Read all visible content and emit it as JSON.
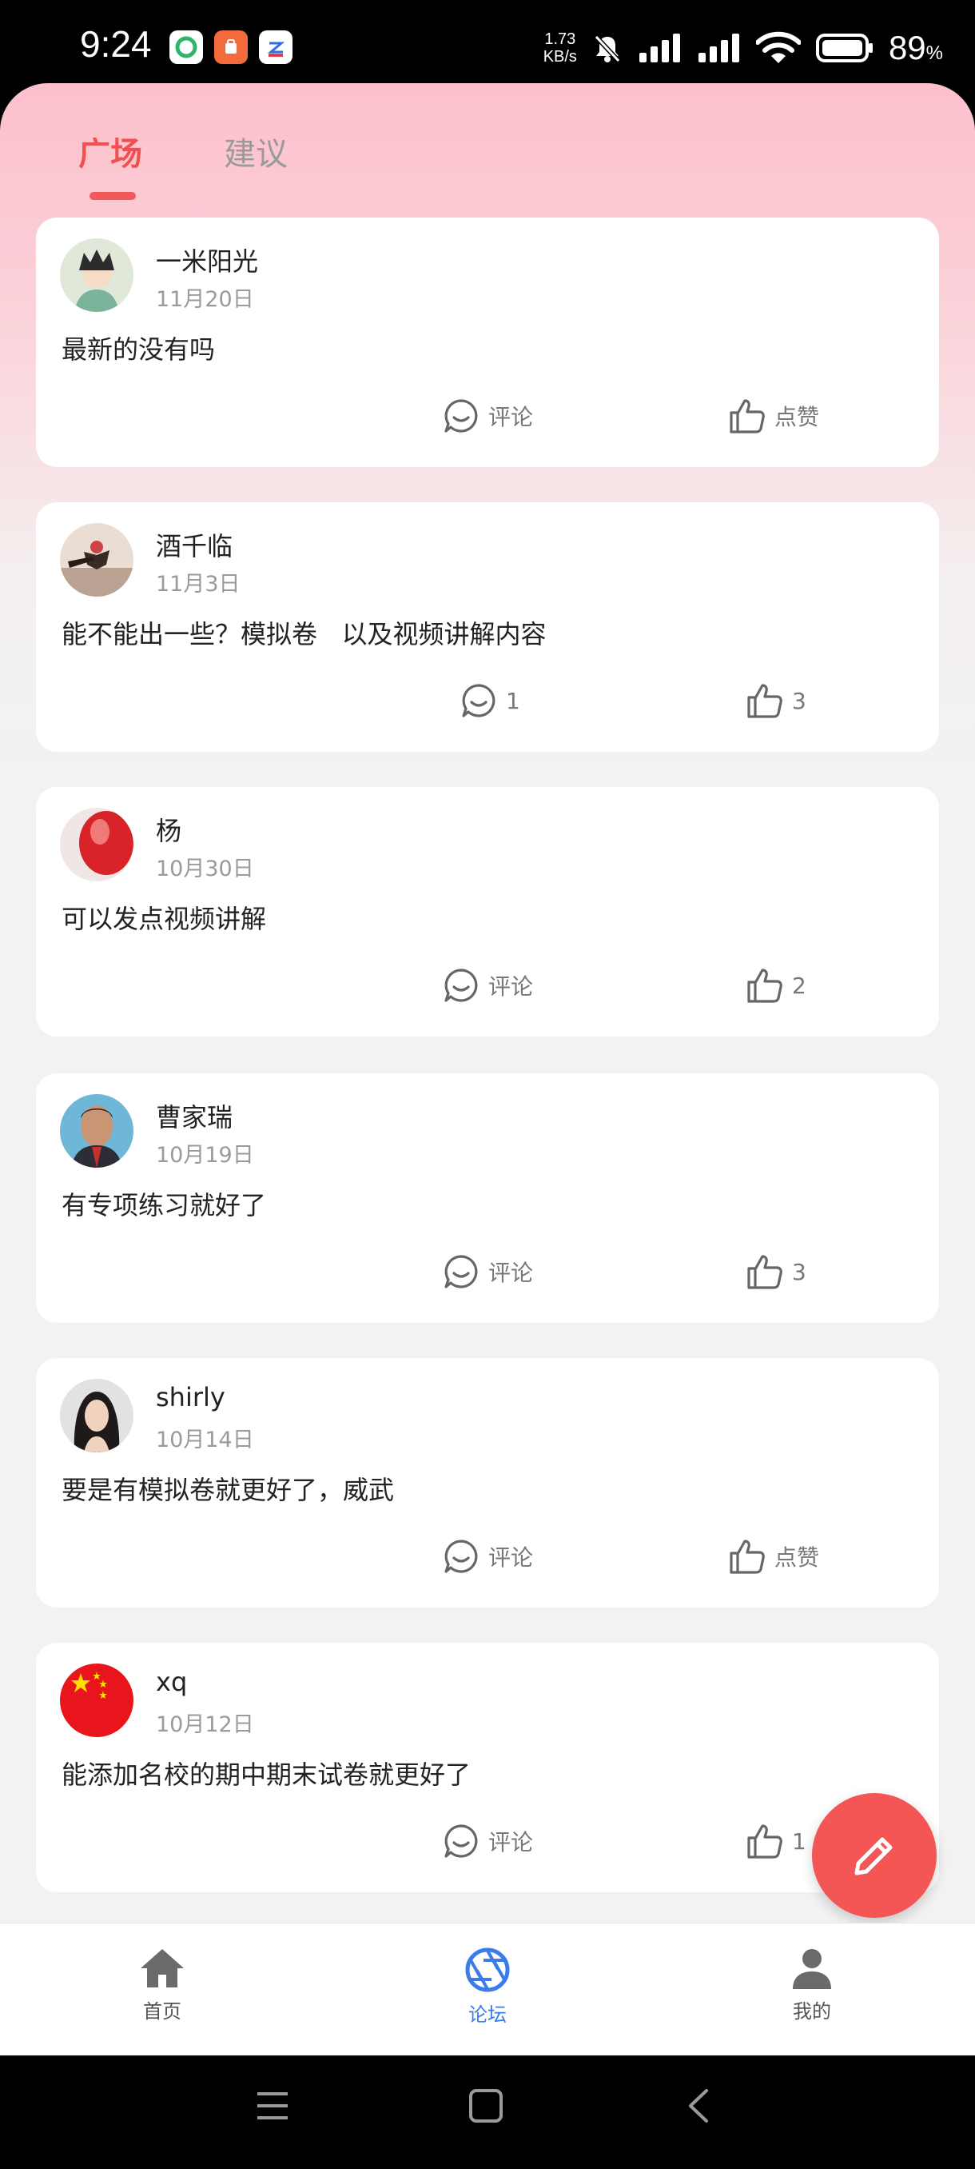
{
  "status_bar": {
    "time": "9:24",
    "net_speed_value": "1.73",
    "net_speed_unit": "KB/s",
    "battery_percent": "89",
    "battery_suffix": "%"
  },
  "tabs": [
    {
      "label": "广场",
      "active": true
    },
    {
      "label": "建议",
      "active": false
    }
  ],
  "posts": [
    {
      "user": "一米阳光",
      "date": "11月20日",
      "content": "最新的没有吗",
      "comment_label": "评论",
      "like_label": "点赞"
    },
    {
      "user": "酒千临",
      "date": "11月3日",
      "content": "能不能出一些？模拟卷   以及视频讲解内容",
      "comment_label": "1",
      "like_label": "3"
    },
    {
      "user": "杨",
      "date": "10月30日",
      "content": "可以发点视频讲解",
      "comment_label": "评论",
      "like_label": "2"
    },
    {
      "user": "曹家瑞",
      "date": "10月19日",
      "content": "有专项练习就好了",
      "comment_label": "评论",
      "like_label": "3"
    },
    {
      "user": "shirly",
      "date": "10月14日",
      "content": "要是有模拟卷就更好了，威武",
      "comment_label": "评论",
      "like_label": "点赞"
    },
    {
      "user": "xq",
      "date": "10月12日",
      "content": "能添加名校的期中期末试卷就更好了",
      "comment_label": "评论",
      "like_label": "1"
    }
  ],
  "bottom_nav": [
    {
      "label": "首页",
      "icon": "home-icon",
      "active": false
    },
    {
      "label": "论坛",
      "icon": "aperture-icon",
      "active": true
    },
    {
      "label": "我的",
      "icon": "person-icon",
      "active": false
    }
  ],
  "colors": {
    "accent_red": "#f05050",
    "fab": "#f45656",
    "active_nav": "#3b7bea"
  }
}
